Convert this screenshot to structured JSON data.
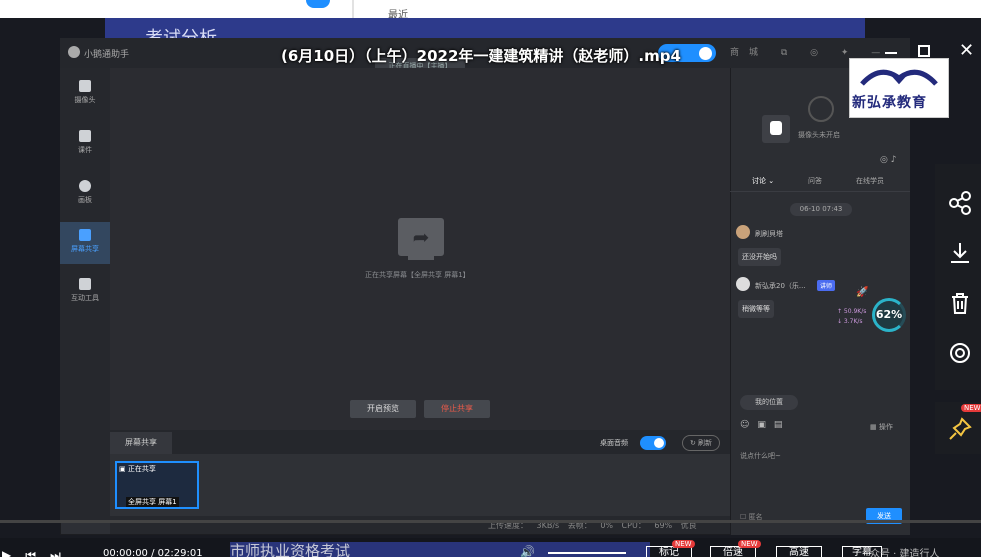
{
  "browser": {
    "tab_text": "最近"
  },
  "slide": {
    "top_text": "考试分析",
    "bottom_text": "市师执业资格考试"
  },
  "video": {
    "title": "(6月10日）（上午）2022年一建建筑精讲（赵老师）.mp4"
  },
  "app": {
    "name": "小鹅通助手",
    "title_icons": "商城 ⧉ ◎ ✦ —",
    "live_pill": "正在直播中【主播】",
    "rail": [
      {
        "label": "摄像头",
        "icon": "camera-icon"
      },
      {
        "label": "课件",
        "icon": "courseware-icon"
      },
      {
        "label": "画板",
        "icon": "palette-icon"
      },
      {
        "label": "屏幕共享",
        "icon": "screen-share-icon"
      },
      {
        "label": "互动工具",
        "icon": "toolbox-icon"
      }
    ],
    "canvas": {
      "sharing_text": "正在共享屏幕【全屏共享 屏幕1】",
      "preview_btn": "开启预览",
      "stop_btn": "停止共享"
    },
    "share_bar": {
      "tab": "屏幕共享",
      "desktop_audio": "桌面音频",
      "refresh": "刷新",
      "thumb_top": "正在共享",
      "thumb_bottom": "全屏共享 屏幕1"
    },
    "status": {
      "text": "上传速度： 3KB/s 丢帧： 0% CPU： 69% 优良"
    },
    "chat": {
      "cam_text": "摄像头未开启",
      "tabs": [
        "讨论",
        "问答",
        "在线学员"
      ],
      "time": "06-10 07:43",
      "messages": [
        {
          "name": "刷刷貝塔",
          "text": "还没开始吗"
        },
        {
          "name": "新弘承20（乐...",
          "badge": "讲师",
          "text": "稍微等等"
        }
      ],
      "speed_percent": "62%",
      "speed_up": "↑ 50.9K/s",
      "speed_down": "↓ 3.7K/s",
      "my_position": "我的位置",
      "ops": "操作",
      "input_placeholder": "说点什么吧~",
      "anon": "匿名",
      "send": "发送"
    }
  },
  "logo": {
    "text": "新弘承教育"
  },
  "player": {
    "time": "00:00:00 / 02:29:01",
    "buttons": [
      {
        "label": "标记",
        "new": "NEW"
      },
      {
        "label": "倍速",
        "new": "NEW"
      },
      {
        "label": "高速",
        "new": ""
      },
      {
        "label": "字幕",
        "new": ""
      }
    ],
    "pin_new": "NEW",
    "watermark": "众号 · 建造行人"
  },
  "colors": {
    "accent": "#1f8fff",
    "danger": "#e53a3a",
    "logo_blue": "#232a7c"
  }
}
